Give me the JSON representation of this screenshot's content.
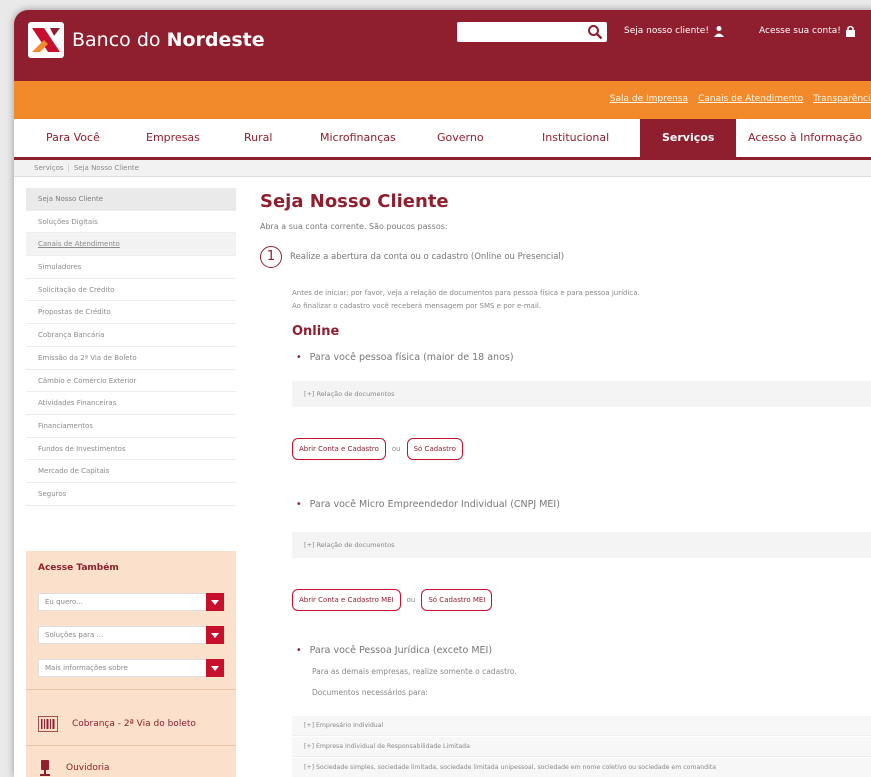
{
  "header": {
    "brand_light": "Banco do ",
    "brand_bold": "Nordeste",
    "search_placeholder": "",
    "client_link": "Seja nosso cliente!",
    "account_link": "Acesse sua conta!"
  },
  "quick_links": [
    "Sala de Imprensa",
    "Canais de Atendimento",
    "Transparência"
  ],
  "nav": {
    "items": [
      "Para Você",
      "Empresas",
      "Rural",
      "Microfinanças",
      "Governo",
      "Institucional",
      "Serviços",
      "Acesso à Informação"
    ],
    "active": "Serviços"
  },
  "breadcrumb": [
    "Serviços",
    "Seja Nosso Cliente"
  ],
  "sidebar": {
    "items": [
      "Seja Nosso Cliente",
      "Soluções Digitais",
      "Canais de Atendimento",
      "Simuladores",
      "Solicitação de Crédito",
      "Propostas de Crédito",
      "Cobrança Bancária",
      "Emissão da 2ª Via de Boleto",
      "Câmbio e Comércio Exterior",
      "Atividades Financeiras",
      "Financiamentos",
      "Fundos de Investimentos",
      "Mercado de Capitais",
      "Seguros"
    ],
    "active_index": 0,
    "highlight_index": 2
  },
  "also": {
    "title": "Acesse Também",
    "selects": [
      "Eu quero...",
      "Soluções para ...",
      "Mais informações sobre"
    ],
    "links": [
      "Cobrança - 2ª Via do boleto",
      "Ouvidoria"
    ]
  },
  "content": {
    "title": "Seja Nosso Cliente",
    "lead": "Abra a sua conta corrente. São poucos passos:",
    "step_number": "1",
    "step_text": "Realize a abertura da conta ou o cadastro (Online ou Presencial)",
    "note1": "Antes de iniciar: por favor, veja a relação de documentos para pessoa física e para pessoa jurídica.",
    "note2": "Ao finalizar o cadastro você receberá mensagem por SMS e por e-mail.",
    "online_heading": "Online",
    "pf_bullet": "Para você pessoa física (maior de 18 anos)",
    "docs_label": "[+] Relação de documentos",
    "btn_open": "Abrir Conta e Cadastro",
    "or": "ou",
    "btn_register": "Só Cadastro",
    "mei_bullet": "Para você Micro Empreendedor Individual (CNPJ MEI)",
    "btn_open_mei": "Abrir Conta e Cadastro MEI",
    "btn_register_mei": "Só Cadastro MEI",
    "pj_bullet": "Para você Pessoa Jurídica (exceto MEI)",
    "pj_sub1": "Para as demais empresas, realize somente o cadastro.",
    "pj_sub2": "Documentos necessários para:",
    "pj_docs": [
      "[+] Empresário Individual",
      "[+] Empresa Individual de Responsabilidade Limitada",
      "[+] Sociedade simples, sociedade limitada, sociedade limitada unipessoal, sociedade em nome coletivo ou sociedade em comandita"
    ]
  },
  "colors": {
    "brand": "#8f1f2f",
    "orange": "#f28a2b",
    "accent": "#c8102e",
    "panel": "#fbe0cc"
  }
}
